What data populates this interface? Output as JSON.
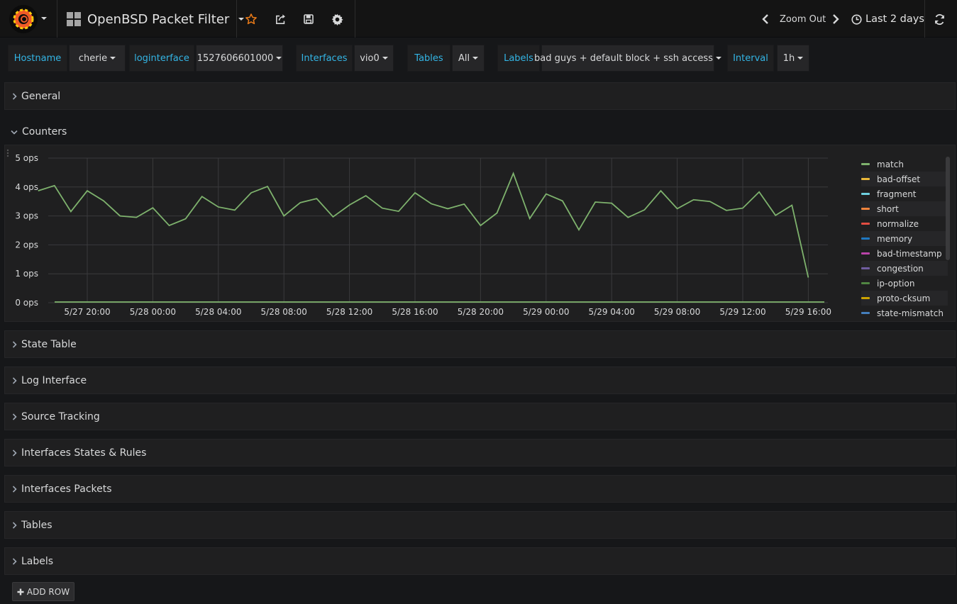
{
  "navbar": {
    "title": "OpenBSD Packet Filter",
    "zoom_label": "Zoom Out",
    "time_range": "Last 2 days",
    "icons": [
      "grafana-logo",
      "star-icon",
      "share-icon",
      "save-icon",
      "gear-icon",
      "chevron-left-icon",
      "chevron-right-icon",
      "clock-icon",
      "refresh-icon"
    ]
  },
  "variables": [
    {
      "label": "Hostname",
      "value": "cherie"
    },
    {
      "label": "loginterface",
      "value": "1527606601000"
    },
    {
      "label": "Interfaces",
      "value": "vio0"
    },
    {
      "label": "Tables",
      "value": "All"
    },
    {
      "label": "Labels",
      "value": "bad guys + default block + ssh access"
    },
    {
      "label": "Interval",
      "value": "1h"
    }
  ],
  "rows": {
    "general": "General",
    "counters": "Counters",
    "state_table": "State Table",
    "log_interface": "Log Interface",
    "source_tracking": "Source Tracking",
    "interfaces_states_rules": "Interfaces States & Rules",
    "interfaces_packets": "Interfaces Packets",
    "tables": "Tables",
    "labels": "Labels"
  },
  "add_row_label": "ADD ROW",
  "colors": {
    "accent": "#33b5e5",
    "star": "#eb7b18",
    "match_series": "#7eb26d",
    "logo": "#f05a28"
  },
  "chart_data": {
    "type": "line",
    "ylim": [
      0,
      5
    ],
    "y_ticks": [
      "0 ops",
      "1 ops",
      "2 ops",
      "3 ops",
      "4 ops",
      "5 ops"
    ],
    "x_ticks": [
      "5/27 20:00",
      "5/28 00:00",
      "5/28 04:00",
      "5/28 08:00",
      "5/28 12:00",
      "5/28 16:00",
      "5/28 20:00",
      "5/29 00:00",
      "5/29 04:00",
      "5/29 08:00",
      "5/29 12:00",
      "5/29 16:00"
    ],
    "x_hours": [
      "5/27 17:00",
      "5/27 18:00",
      "5/27 19:00",
      "5/27 20:00",
      "5/27 21:00",
      "5/27 22:00",
      "5/27 23:00",
      "5/28 00:00",
      "5/28 01:00",
      "5/28 02:00",
      "5/28 03:00",
      "5/28 04:00",
      "5/28 05:00",
      "5/28 06:00",
      "5/28 07:00",
      "5/28 08:00",
      "5/28 09:00",
      "5/28 10:00",
      "5/28 11:00",
      "5/28 12:00",
      "5/28 13:00",
      "5/28 14:00",
      "5/28 15:00",
      "5/28 16:00",
      "5/28 17:00",
      "5/28 18:00",
      "5/28 19:00",
      "5/28 20:00",
      "5/28 21:00",
      "5/28 22:00",
      "5/28 23:00",
      "5/29 00:00",
      "5/29 01:00",
      "5/29 02:00",
      "5/29 03:00",
      "5/29 04:00",
      "5/29 05:00",
      "5/29 06:00",
      "5/29 07:00",
      "5/29 08:00",
      "5/29 09:00",
      "5/29 10:00",
      "5/29 11:00",
      "5/29 12:00",
      "5/29 13:00",
      "5/29 14:00",
      "5/29 15:00",
      "5/29 16:00",
      "5/29 16:35"
    ],
    "series": [
      {
        "name": "match",
        "color": "#7eb26d",
        "values": [
          3.87,
          4.05,
          3.15,
          3.87,
          3.52,
          3.0,
          2.95,
          3.28,
          2.67,
          2.9,
          3.67,
          3.31,
          3.2,
          3.8,
          4.02,
          3.0,
          3.46,
          3.6,
          2.97,
          3.38,
          3.7,
          3.27,
          3.16,
          3.8,
          3.42,
          3.25,
          3.41,
          2.67,
          3.1,
          4.47,
          2.91,
          3.76,
          3.52,
          2.52,
          3.48,
          3.44,
          2.95,
          3.21,
          3.87,
          3.25,
          3.56,
          3.5,
          3.19,
          3.27,
          3.83,
          3.02,
          3.37,
          0.87
        ]
      },
      {
        "name": "bad-offset",
        "color": "#eab839",
        "values": []
      },
      {
        "name": "fragment",
        "color": "#6ed0e0",
        "values": []
      },
      {
        "name": "short",
        "color": "#ef843c",
        "values": []
      },
      {
        "name": "normalize",
        "color": "#e24d42",
        "values": []
      },
      {
        "name": "memory",
        "color": "#1f78c1",
        "values": []
      },
      {
        "name": "bad-timestamp",
        "color": "#ba43a9",
        "values": []
      },
      {
        "name": "congestion",
        "color": "#705da0",
        "values": []
      },
      {
        "name": "ip-option",
        "color": "#508642",
        "values": []
      },
      {
        "name": "proto-cksum",
        "color": "#cca300",
        "values": []
      },
      {
        "name": "state-mismatch",
        "color": "#447ebc",
        "values": []
      }
    ]
  }
}
